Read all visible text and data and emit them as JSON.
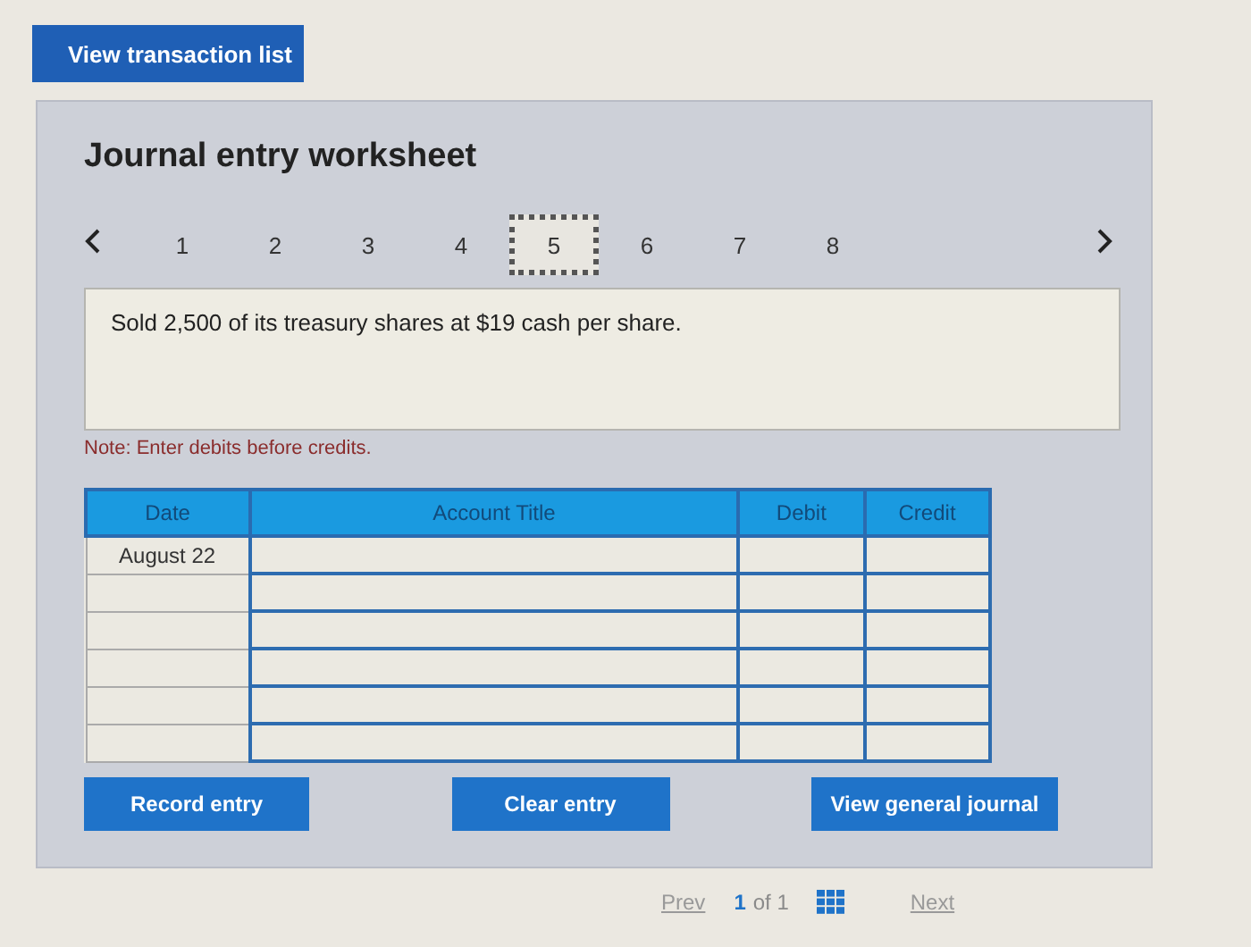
{
  "top_button": "View transaction list",
  "title": "Journal entry worksheet",
  "tabs": [
    {
      "label": "1",
      "selected": false
    },
    {
      "label": "2",
      "selected": false
    },
    {
      "label": "3",
      "selected": false
    },
    {
      "label": "4",
      "selected": false
    },
    {
      "label": "5",
      "selected": true
    },
    {
      "label": "6",
      "selected": false
    },
    {
      "label": "7",
      "selected": false
    },
    {
      "label": "8",
      "selected": false
    }
  ],
  "description": "Sold 2,500 of its treasury shares at $19 cash per share.",
  "note": "Note: Enter debits before credits.",
  "table": {
    "columns": [
      "Date",
      "Account Title",
      "Debit",
      "Credit"
    ],
    "rows": [
      {
        "date": "August 22"
      },
      {},
      {},
      {},
      {},
      {}
    ]
  },
  "buttons": [
    "Record entry",
    "Clear entry",
    "View general journal"
  ],
  "pager": {
    "prev": "Prev",
    "current": "1",
    "total": "of 1",
    "next": "Next"
  }
}
